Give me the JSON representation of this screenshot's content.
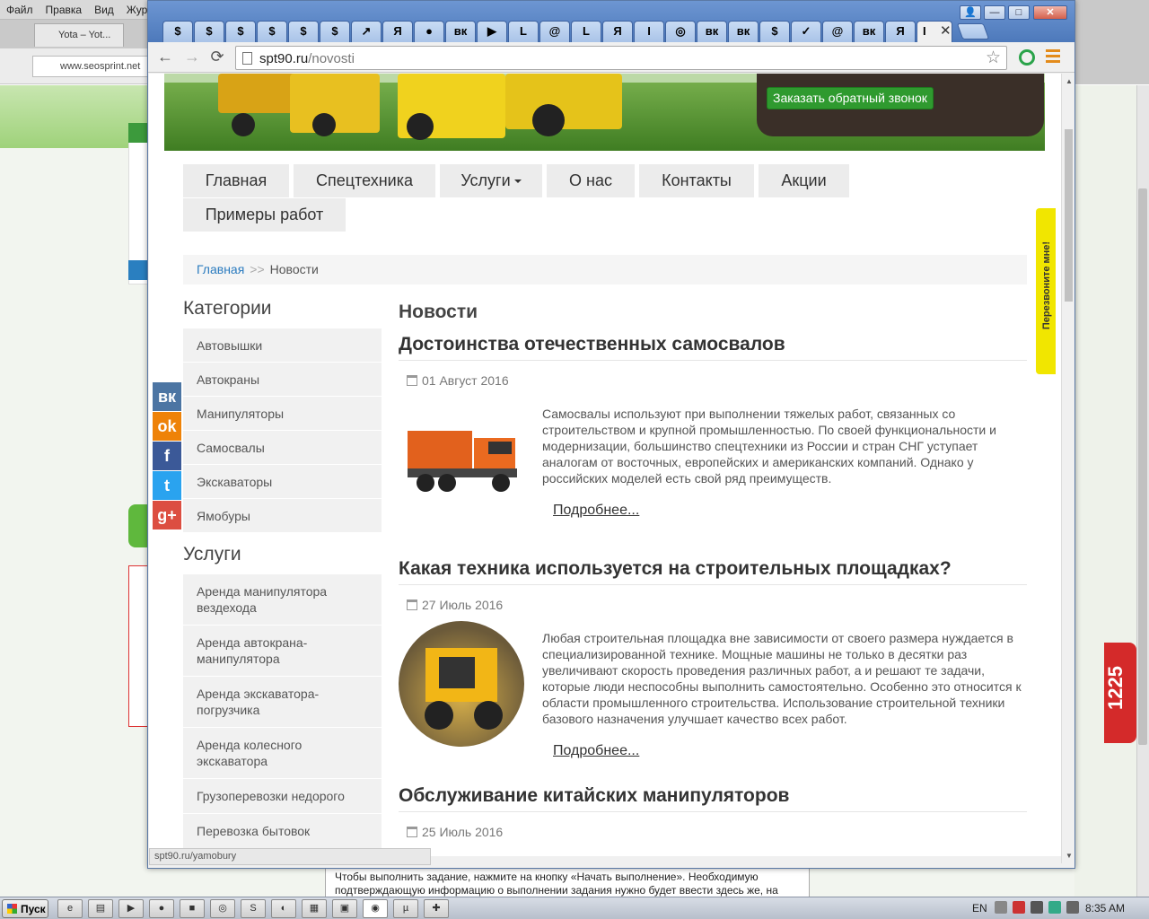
{
  "background_browser": {
    "menu": [
      "Файл",
      "Правка",
      "Вид",
      "Жур"
    ],
    "tab_title": "Yota – Yot...",
    "url": "www.seosprint.net",
    "taskbar_tip": "Чтобы выполнить задание, нажмите на кнопку «Начать выполнение». Необходимую подтверждающую информацию о выполнении задания нужно будет ввести здесь же, на",
    "badge": "1225"
  },
  "chrome": {
    "url_host": "spt90.ru",
    "url_path": "/novosti",
    "status_url": "spt90.ru/yamobury",
    "tabs": [
      "$",
      "$",
      "$",
      "$",
      "$",
      "$",
      "↗",
      "Я",
      "●",
      "вк",
      "▶",
      "L",
      "@",
      "L",
      "Я",
      "I",
      "◎",
      "вк",
      "вк",
      "$",
      "✓",
      "@",
      "вк",
      "Я"
    ],
    "active_tab": "I",
    "window_controls": [
      "👤",
      "—",
      "□",
      "✕"
    ]
  },
  "site": {
    "callback_button": "Заказать обратный звонок",
    "callme_tab": "Перезвоните мне!",
    "nav": [
      "Главная",
      "Спецтехника",
      "Услуги",
      "О нас",
      "Контакты",
      "Акции",
      "Примеры работ"
    ],
    "breadcrumb": {
      "home": "Главная",
      "sep": ">>",
      "current": "Новости"
    },
    "sidebar": {
      "categories_title": "Категории",
      "categories": [
        "Автовышки",
        "Автокраны",
        "Манипуляторы",
        "Самосвалы",
        "Экскаваторы",
        "Ямобуры"
      ],
      "services_title": "Услуги",
      "services": [
        "Аренда манипулятора вездехода",
        "Аренда автокрана-манипулятора",
        "Аренда экскаватора-погрузчика",
        "Аренда колесного экскаватора",
        "Грузоперевозки недорого",
        "Перевозка бытовок"
      ]
    },
    "main_title": "Новости",
    "more_label": "Подробнее...",
    "articles": [
      {
        "title": "Достоинства отечественных самосвалов",
        "date": "01 Август 2016",
        "text": "Самосвалы используют при выполнении тяжелых работ, связанных со строительством и крупной промышленностью. По своей функциональности и модернизации, большинство спецтехники из России и стран СНГ уступает аналогам от восточных, европейских и американских компаний. Однако у российских моделей есть свой ряд преимуществ."
      },
      {
        "title": "Какая техника используется на строительных площадках?",
        "date": "27 Июль 2016",
        "text": "Любая строительная площадка вне зависимости от своего размера нуждается в специализированной технике. Мощные машины не только в десятки раз увеличивают скорость проведения различных работ, а и решают те задачи, которые люди неспособны выполнить самостоятельно. Особенно это относится к области промышленного строительства. Использование строительной техники базового назначения улучшает качество всех работ."
      },
      {
        "title": "Обслуживание китайских манипуляторов",
        "date": "25 Июль 2016"
      }
    ],
    "social": [
      "вк",
      "ok",
      "f",
      "t",
      "g+"
    ]
  },
  "taskbar": {
    "start": "Пуск",
    "lang": "EN",
    "clock": "8:35 AM"
  }
}
